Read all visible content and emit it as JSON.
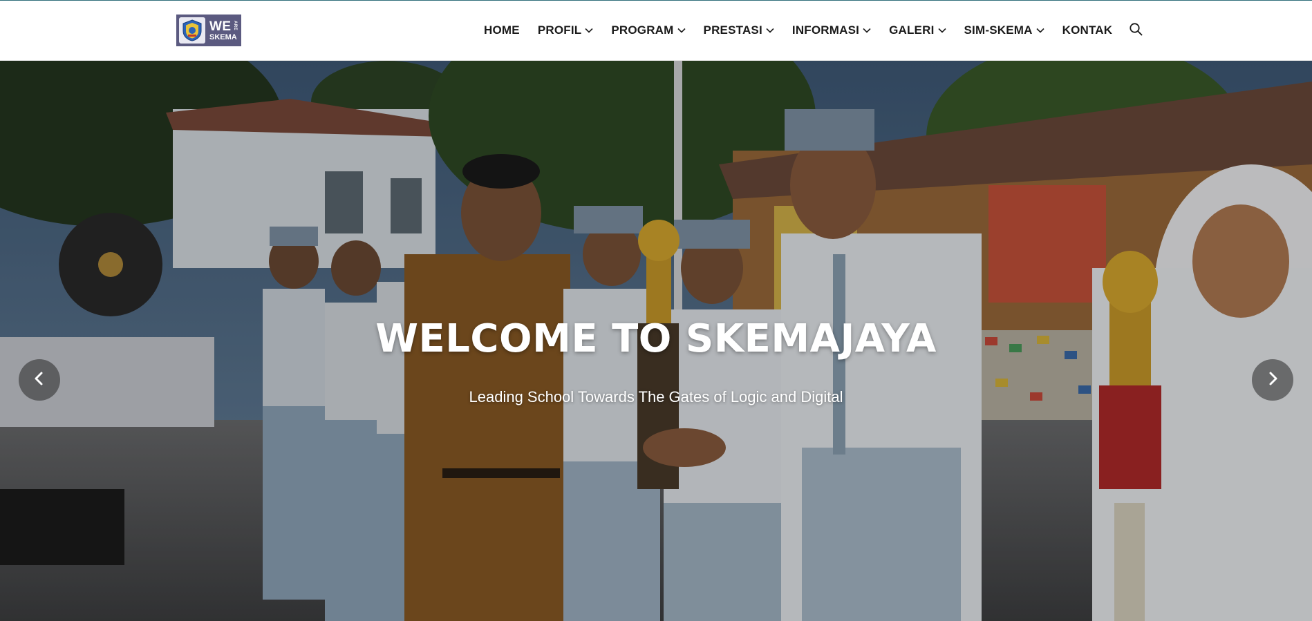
{
  "logo": {
    "main_text": "WE",
    "small_vertical_text": "ARE",
    "sub_text": "SKEMA"
  },
  "nav": {
    "items": [
      {
        "label": "HOME",
        "has_dropdown": false
      },
      {
        "label": "PROFIL",
        "has_dropdown": true
      },
      {
        "label": "PROGRAM",
        "has_dropdown": true
      },
      {
        "label": "PRESTASI",
        "has_dropdown": true
      },
      {
        "label": "INFORMASI",
        "has_dropdown": true
      },
      {
        "label": "GALERI",
        "has_dropdown": true
      },
      {
        "label": "SIM-SKEMA",
        "has_dropdown": true
      },
      {
        "label": "KONTAK",
        "has_dropdown": false
      }
    ],
    "search_icon": "search-icon"
  },
  "hero": {
    "title": "WELCOME TO SKEMAJAYA",
    "subtitle": "Leading School Towards The Gates of Logic and Digital",
    "prev_icon": "chevron-left-icon",
    "next_icon": "chevron-right-icon"
  },
  "colors": {
    "logo_bg": "#5b5a80",
    "nav_text": "#1a1a1a",
    "hero_text": "#ffffff"
  }
}
